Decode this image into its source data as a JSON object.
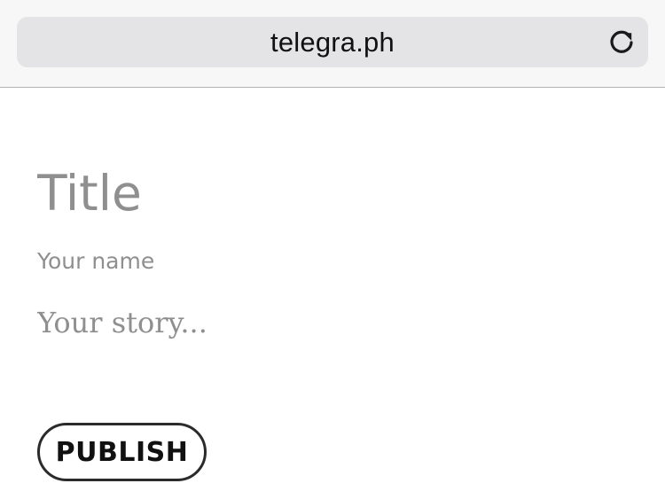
{
  "browser": {
    "url": "telegra.ph",
    "reload_icon": "reload-icon"
  },
  "editor": {
    "title_placeholder": "Title",
    "author_placeholder": "Your name",
    "story_placeholder": "Your story...",
    "title_value": "",
    "author_value": "",
    "story_value": "",
    "publish_label": "PUBLISH"
  },
  "colors": {
    "placeholder": "#8f8f8f",
    "button_border": "#2b2b2b",
    "url_field_bg": "#e4e4e6",
    "toolbar_bg": "#f7f7f7"
  }
}
